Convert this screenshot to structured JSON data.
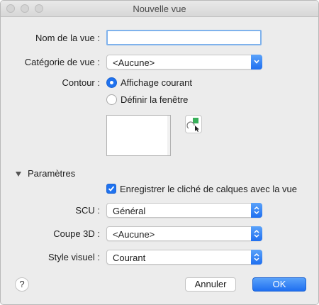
{
  "window": {
    "title": "Nouvelle vue"
  },
  "form": {
    "view_name": {
      "label": "Nom de la vue :",
      "value": ""
    },
    "category": {
      "label": "Catégorie de vue :",
      "value": "<Aucune>"
    },
    "boundary": {
      "label": "Contour :",
      "options": [
        {
          "label": "Affichage courant",
          "selected": true
        },
        {
          "label": "Définir la fenêtre",
          "selected": false
        }
      ]
    },
    "settings": {
      "label": "Paramètres",
      "save_layer_snapshot": {
        "label": "Enregistrer le cliché de calques avec la vue",
        "checked": true
      },
      "ucs": {
        "label": "SCU :",
        "value": "Général"
      },
      "section3d": {
        "label": "Coupe 3D :",
        "value": "<Aucune>"
      },
      "visual_style": {
        "label": "Style visuel :",
        "value": "Courant"
      }
    }
  },
  "buttons": {
    "help": "?",
    "cancel": "Annuler",
    "ok": "OK"
  },
  "colors": {
    "accent": "#1f72ef",
    "focus_ring": "#7fb2ec",
    "window_bg": "#ececec"
  }
}
